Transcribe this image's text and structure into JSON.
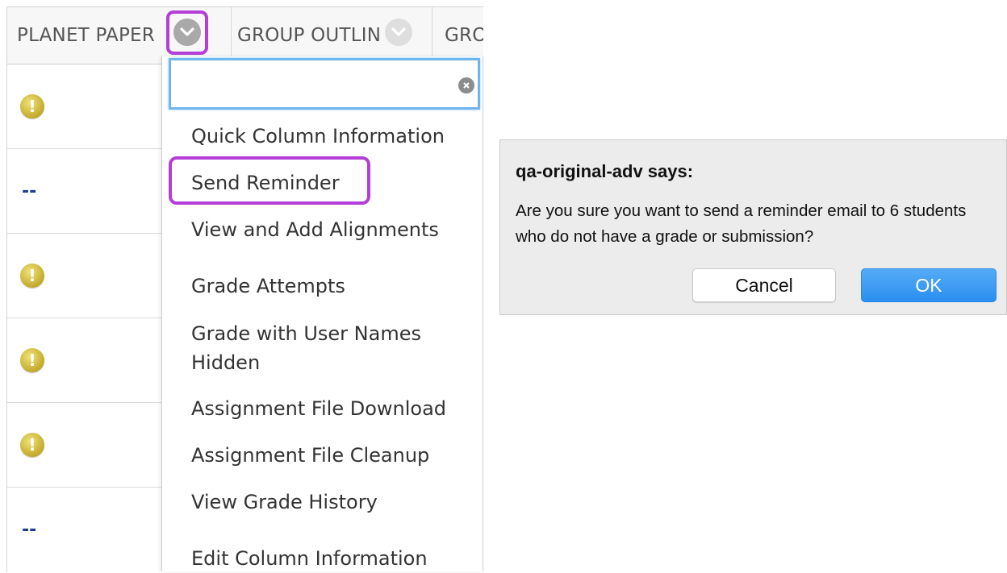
{
  "grid": {
    "columns": [
      {
        "label": "PLANET PAPER"
      },
      {
        "label": "GROUP OUTLIN"
      },
      {
        "label": "GRO"
      }
    ],
    "rows": [
      {
        "type": "needs-grading",
        "value": "!"
      },
      {
        "type": "empty",
        "value": "--"
      },
      {
        "type": "needs-grading",
        "value": "!"
      },
      {
        "type": "needs-grading",
        "value": "!"
      },
      {
        "type": "needs-grading",
        "value": "!"
      },
      {
        "type": "empty",
        "value": "--"
      }
    ]
  },
  "menu": {
    "search_value": "",
    "items": [
      "Quick Column Information",
      "Send Reminder",
      "View and Add Alignments",
      "Grade Attempts",
      "Grade with User Names",
      "Hidden",
      "Assignment File Download",
      "Assignment File Cleanup",
      "View Grade History",
      "Edit Column Information"
    ]
  },
  "dialog": {
    "title": "qa-original-adv says:",
    "message": "Are you sure you want to send a reminder email to 6 students who do not have a grade or submission?",
    "cancel_label": "Cancel",
    "ok_label": "OK"
  },
  "colors": {
    "highlight": "#b43fd6",
    "ok_button": "#2a8ef0",
    "focus_border": "#6fb6ee"
  },
  "icons": {
    "column_menu": "chevron-down-icon",
    "needs_grading": "exclamation-icon",
    "clear_search": "clear-icon"
  }
}
